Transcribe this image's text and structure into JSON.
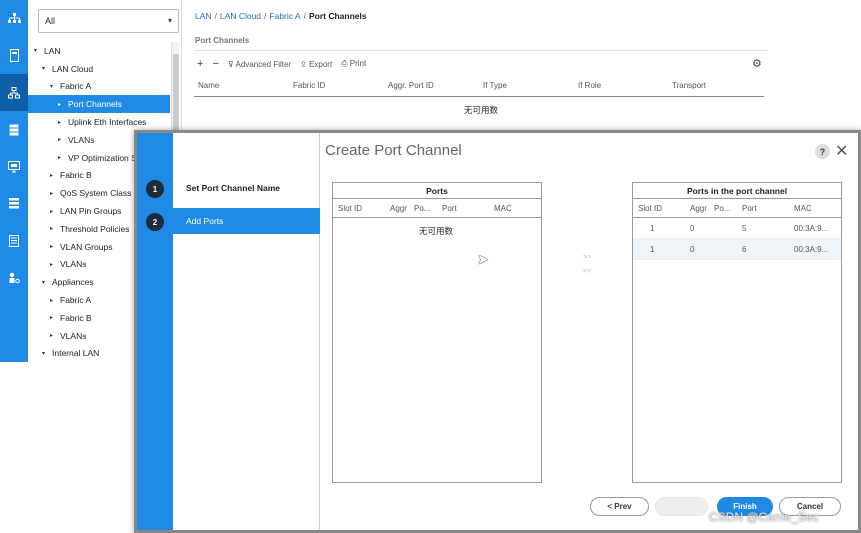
{
  "colors": {
    "accent": "#1e8ae6",
    "accent_dark": "#0f5fa8",
    "step_circle": "#1d2b3a"
  },
  "iconbar": {
    "icons": [
      "network-icon",
      "server-icon",
      "lan-icon",
      "storage-icon",
      "vm-icon",
      "chassis-icon",
      "admin-icon",
      "user-icon"
    ]
  },
  "tree": {
    "filter_value": "All",
    "nodes": [
      {
        "label": "LAN",
        "level": 0,
        "toggle": "▾"
      },
      {
        "label": "LAN Cloud",
        "level": 1,
        "toggle": "▾"
      },
      {
        "label": "Fabric A",
        "level": 2,
        "toggle": "▾"
      },
      {
        "label": "Port Channels",
        "level": 3,
        "toggle": "▸",
        "selected": true
      },
      {
        "label": "Uplink Eth Interfaces",
        "level": 3,
        "toggle": "▸"
      },
      {
        "label": "VLANs",
        "level": 3,
        "toggle": "▸"
      },
      {
        "label": "VP Optimization Sets",
        "level": 3,
        "toggle": "▸"
      },
      {
        "label": "Fabric B",
        "level": 2,
        "toggle": "▸"
      },
      {
        "label": "QoS System Class",
        "level": 2,
        "toggle": "▸"
      },
      {
        "label": "LAN Pin Groups",
        "level": 2,
        "toggle": "▸"
      },
      {
        "label": "Threshold Policies",
        "level": 2,
        "toggle": "▸"
      },
      {
        "label": "VLAN Groups",
        "level": 2,
        "toggle": "▸"
      },
      {
        "label": "VLANs",
        "level": 2,
        "toggle": "▸"
      },
      {
        "label": "Appliances",
        "level": 1,
        "toggle": "▾"
      },
      {
        "label": "Fabric A",
        "level": 2,
        "toggle": "▸"
      },
      {
        "label": "Fabric B",
        "level": 2,
        "toggle": "▸"
      },
      {
        "label": "VLANs",
        "level": 2,
        "toggle": "▸"
      },
      {
        "label": "Internal LAN",
        "level": 1,
        "toggle": "▾"
      }
    ]
  },
  "main": {
    "breadcrumb": [
      "LAN",
      "LAN Cloud",
      "Fabric A"
    ],
    "breadcrumb_current": "Port Channels",
    "breadcrumb_sep": "/",
    "panel_title": "Port Channels",
    "toolbar": {
      "add": "+",
      "remove": "−",
      "filter": "Advanced Filter",
      "export": "Export",
      "print": "Print"
    },
    "columns": [
      "Name",
      "Fabric ID",
      "Aggr. Port ID",
      "If Type",
      "If Role",
      "Transport"
    ],
    "empty_text": "无可用数"
  },
  "dialog": {
    "title": "Create Port Channel",
    "help": "?",
    "close": "✕",
    "steps": [
      {
        "num": "1",
        "label": "Set Port Channel Name"
      },
      {
        "num": "2",
        "label": "Add Ports"
      }
    ],
    "ports": {
      "header": "Ports",
      "columns": [
        "Slot ID",
        "Aggr",
        "Po...",
        "Port",
        "MAC"
      ],
      "empty_text": "无可用数"
    },
    "ports_in_channel": {
      "header": "Ports in the port channel",
      "columns": [
        "Slot ID",
        "Aggr",
        "Po...",
        "Port",
        "MAC"
      ],
      "rows": [
        {
          "slot": "1",
          "aggr": "0",
          "port": "5",
          "mac": "00:3A:9..."
        },
        {
          "slot": "1",
          "aggr": "0",
          "port": "6",
          "mac": "00:3A:9..."
        }
      ]
    },
    "arrows": [
      ">>",
      "<<"
    ],
    "buttons": {
      "prev": "< Prev",
      "next": "Next >",
      "finish": "Finish",
      "cancel": "Cancel"
    }
  },
  "watermark": "CSDN @Carrie_Sec"
}
